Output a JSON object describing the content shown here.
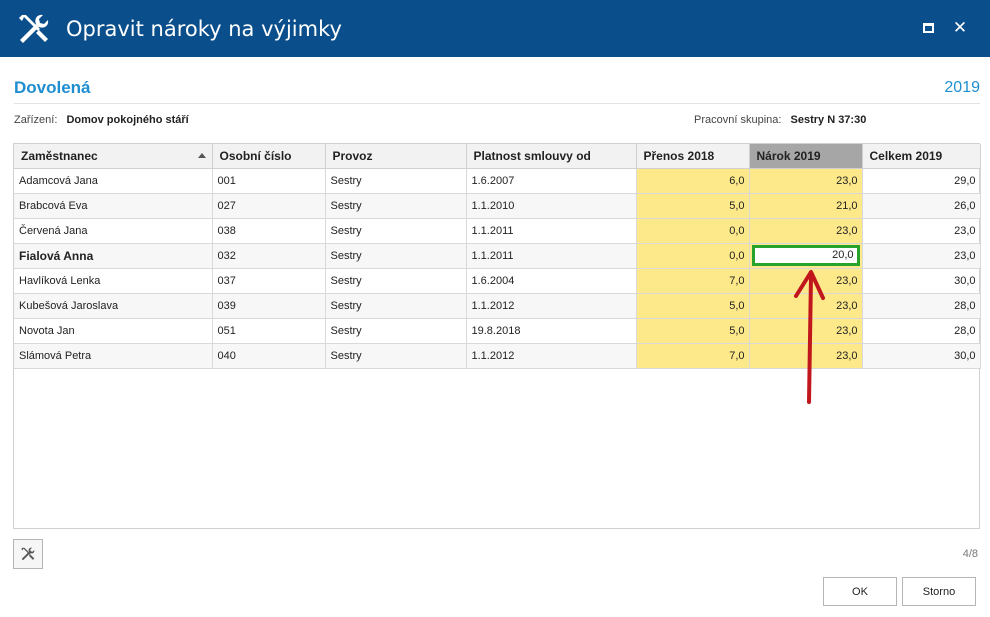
{
  "window": {
    "title": "Opravit nároky na výjimky",
    "icon": "wrench-screwdriver-icon",
    "maximize_icon": "maximize-icon",
    "close_icon": "close-icon"
  },
  "header": {
    "section_title": "Dovolená",
    "year": "2019",
    "facility_label": "Zařízení:",
    "facility_value": "Domov pokojného stáří",
    "workgroup_label": "Pracovní skupina:",
    "workgroup_value": "Sestry N 37:30"
  },
  "table": {
    "columns": [
      "Zaměstnanec",
      "Osobní číslo",
      "Provoz",
      "Platnost smlouvy od",
      "Přenos 2018",
      "Nárok 2019",
      "Celkem 2019"
    ],
    "rows": [
      [
        "Adamcová Jana",
        "001",
        "Sestry",
        "1.6.2007",
        "6,0",
        "23,0",
        "29,0"
      ],
      [
        "Brabcová Eva",
        "027",
        "Sestry",
        "1.1.2010",
        "5,0",
        "21,0",
        "26,0"
      ],
      [
        "Červená Jana",
        "038",
        "Sestry",
        "1.1.2011",
        "0,0",
        "23,0",
        "23,0"
      ],
      [
        "Fialová Anna",
        "032",
        "Sestry",
        "1.1.2011",
        "0,0",
        "20,0",
        "23,0"
      ],
      [
        "Havlíková Lenka",
        "037",
        "Sestry",
        "1.6.2004",
        "7,0",
        "23,0",
        "30,0"
      ],
      [
        "Kubešová Jaroslava",
        "039",
        "Sestry",
        "1.1.2012",
        "5,0",
        "23,0",
        "28,0"
      ],
      [
        "Novota Jan",
        "051",
        "Sestry",
        "19.8.2018",
        "5,0",
        "23,0",
        "28,0"
      ],
      [
        "Slámová Petra",
        "040",
        "Sestry",
        "1.1.2012",
        "7,0",
        "23,0",
        "30,0"
      ]
    ],
    "editing_row": 3
  },
  "footer": {
    "tool_icon": "wrench-screwdriver-icon",
    "pager": "4/8",
    "ok_label": "OK",
    "cancel_label": "Storno"
  },
  "colors": {
    "titlebar": "#0a4f8c",
    "accent": "#1f8ed0",
    "editable_cell": "#fee98a",
    "edit_border": "#27a22d",
    "annotation_arrow": "#c0161c"
  }
}
